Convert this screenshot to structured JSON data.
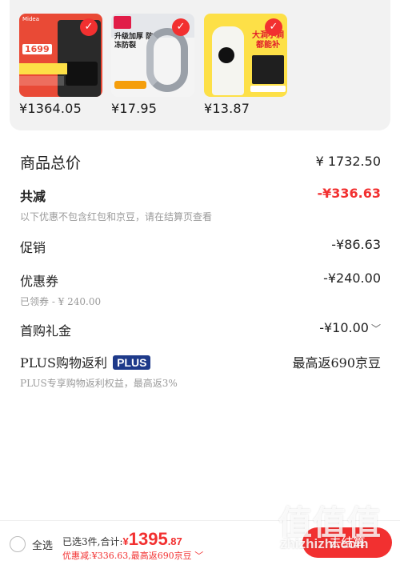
{
  "products": [
    {
      "price": "¥1364.05",
      "image": "water-heater-product-image",
      "brand_text": "Midea",
      "tag_text": "1699"
    },
    {
      "price": "¥17.95",
      "image": "drain-hose-product-image",
      "headline": "升级加厚 防冻防裂"
    },
    {
      "price": "¥13.87",
      "image": "coat-patch-product-image",
      "headline": "大洞小洞 都能补"
    }
  ],
  "summary": {
    "goods_total_label": "商品总价",
    "goods_total_value": "¥ 1732.50",
    "total_discount_label": "共减",
    "total_discount_value": "-¥336.63",
    "total_discount_note": "以下优惠不包含红包和京豆，请在结算页查看",
    "promotion_label": "促销",
    "promotion_value": "-¥86.63",
    "coupon_label": "优惠券",
    "coupon_value": "-¥240.00",
    "coupon_note": "已领券 - ¥ 240.00",
    "first_gift_label": "首购礼金",
    "first_gift_value": "-¥10.00",
    "plus_label": "PLUS购物返利",
    "plus_badge": "PLUS",
    "plus_value": "最高返690京豆",
    "plus_note": "PLUS专享购物返利权益，最高返3%"
  },
  "bottom_bar": {
    "select_all_label": "全选",
    "selected_text": "已选3件,合计:",
    "total_yen": "¥",
    "total_int": "1395",
    "total_dec": ".87",
    "discount_text": "优惠减:¥336.63,最高返690京豆",
    "checkout_label": "去结算"
  },
  "watermark": {
    "logo_text": "值值值",
    "url_text": "zhizhizhi.com"
  },
  "colors": {
    "accent": "#f23030",
    "plus_badge": "#1e3a8a",
    "panel": "#f2f2f2"
  }
}
